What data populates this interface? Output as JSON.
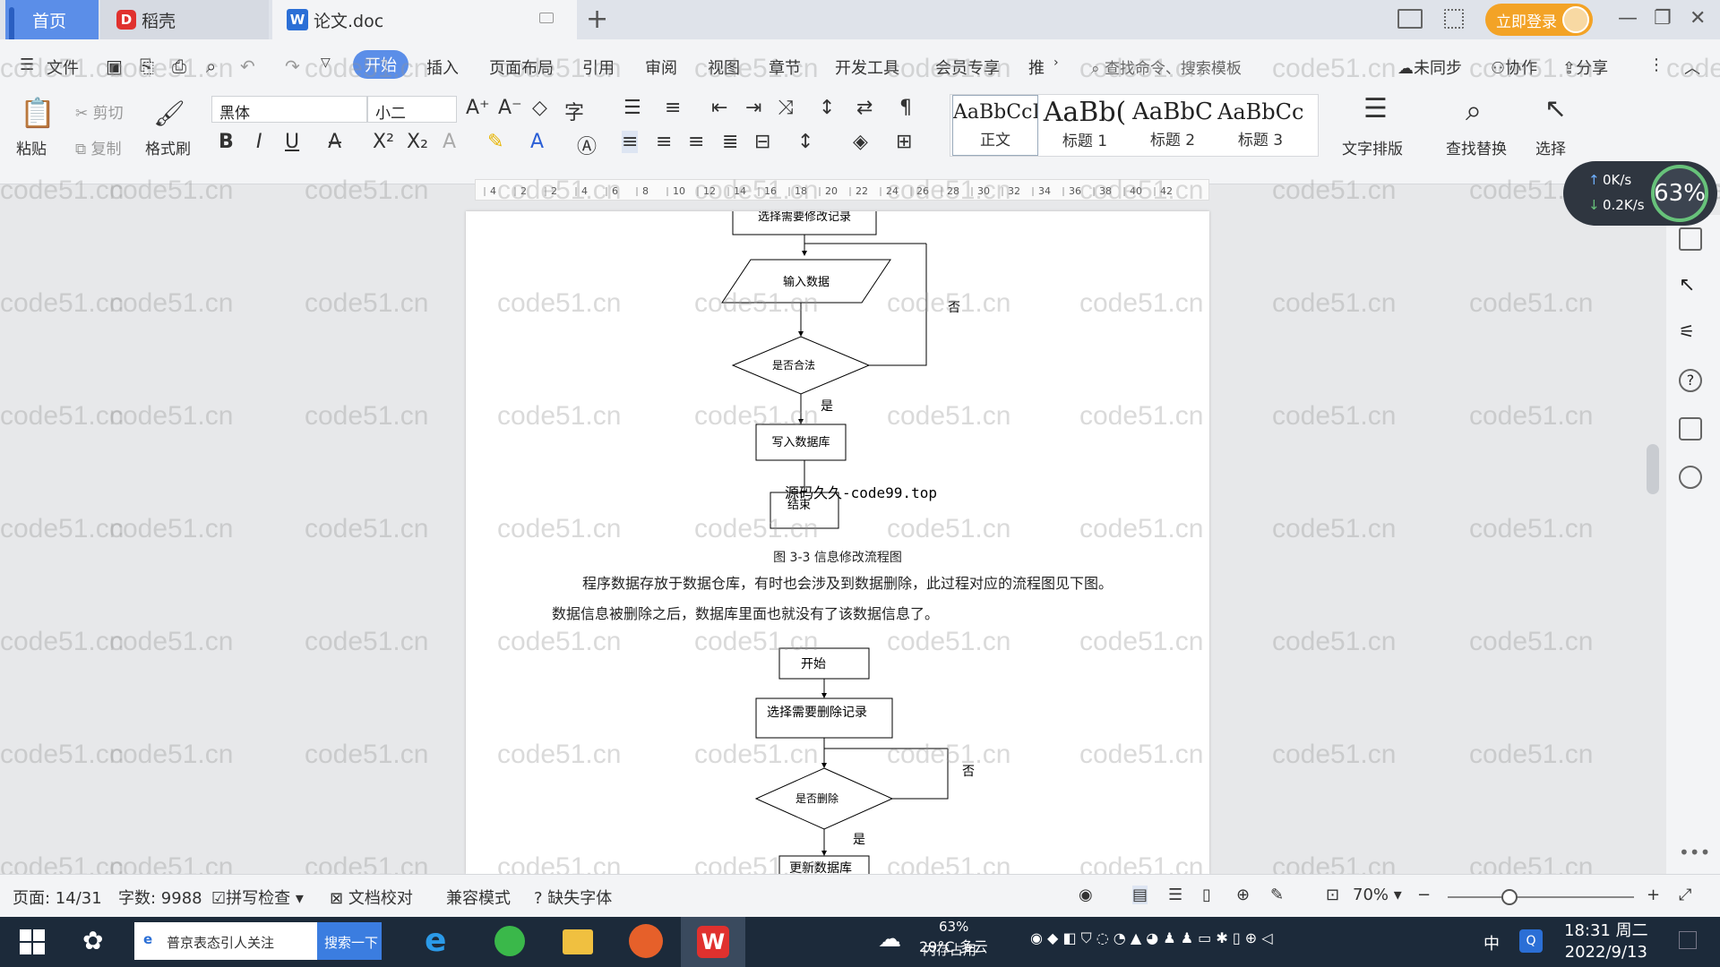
{
  "tabs": {
    "home": "首页",
    "daoke": "稻壳",
    "doc": "论文.doc",
    "login": "立即登录"
  },
  "menu": {
    "file": "文件",
    "items": [
      "开始",
      "插入",
      "页面布局",
      "引用",
      "审阅",
      "视图",
      "章节",
      "开发工具",
      "会员专享",
      "推"
    ],
    "search": "查找命令、搜索模板",
    "sync": "未同步",
    "collab": "协作",
    "share": "分享"
  },
  "toolbar": {
    "paste": "粘贴",
    "cut": "剪切",
    "copy": "复制",
    "format_painter": "格式刷",
    "font": "黑体",
    "size": "小二",
    "styles": [
      {
        "sample": "AaBbCcI",
        "name": "正文"
      },
      {
        "sample": "AaBb(",
        "name": "标题 1"
      },
      {
        "sample": "AaBbC",
        "name": "标题 2"
      },
      {
        "sample": "AaBbCc",
        "name": "标题 3"
      }
    ],
    "text_layout": "文字排版",
    "find_replace": "查找替换",
    "select": "选择"
  },
  "ruler": [
    "4",
    "2",
    "2",
    "4",
    "6",
    "8",
    "10",
    "12",
    "14",
    "16",
    "18",
    "20",
    "22",
    "24",
    "26",
    "28",
    "30",
    "32",
    "34",
    "36",
    "38",
    "40",
    "42"
  ],
  "document": {
    "flow1": {
      "top_box": "选择需要修改记录",
      "input": "输入数据",
      "decision": "是否合法",
      "no": "否",
      "yes": "是",
      "write": "写入数据库",
      "end": "结束"
    },
    "overlay_text": "源码久久-code99.top",
    "caption": "图 3-3 信息修改流程图",
    "para1": "程序数据存放于数据仓库，有时也会涉及到数据删除，此过程对应的流程图见下图。",
    "para2": "数据信息被删除之后，数据库里面也就没有了该数据信息了。",
    "flow2": {
      "start": "开始",
      "select": "选择需要删除记录",
      "decision": "是否删除",
      "no": "否",
      "yes": "是",
      "update": "更新数据库"
    }
  },
  "watermark": "code51.cn",
  "speed": {
    "up": "0K/s",
    "down": "0.2K/s",
    "pct": "63%"
  },
  "status": {
    "page": "页面: 14/31",
    "words": "字数: 9988",
    "spell": "拼写检查",
    "proof": "文档校对",
    "compat": "兼容模式",
    "missing_font": "缺失字体",
    "zoom": "70%"
  },
  "taskbar": {
    "search_text": "普京表态引人关注",
    "search_btn": "搜索一下",
    "weather": "29°C 多云",
    "mem_pct": "63%",
    "mem_label": "内存占用",
    "ime": "中",
    "time": "18:31 周二",
    "date": "2022/9/13"
  }
}
